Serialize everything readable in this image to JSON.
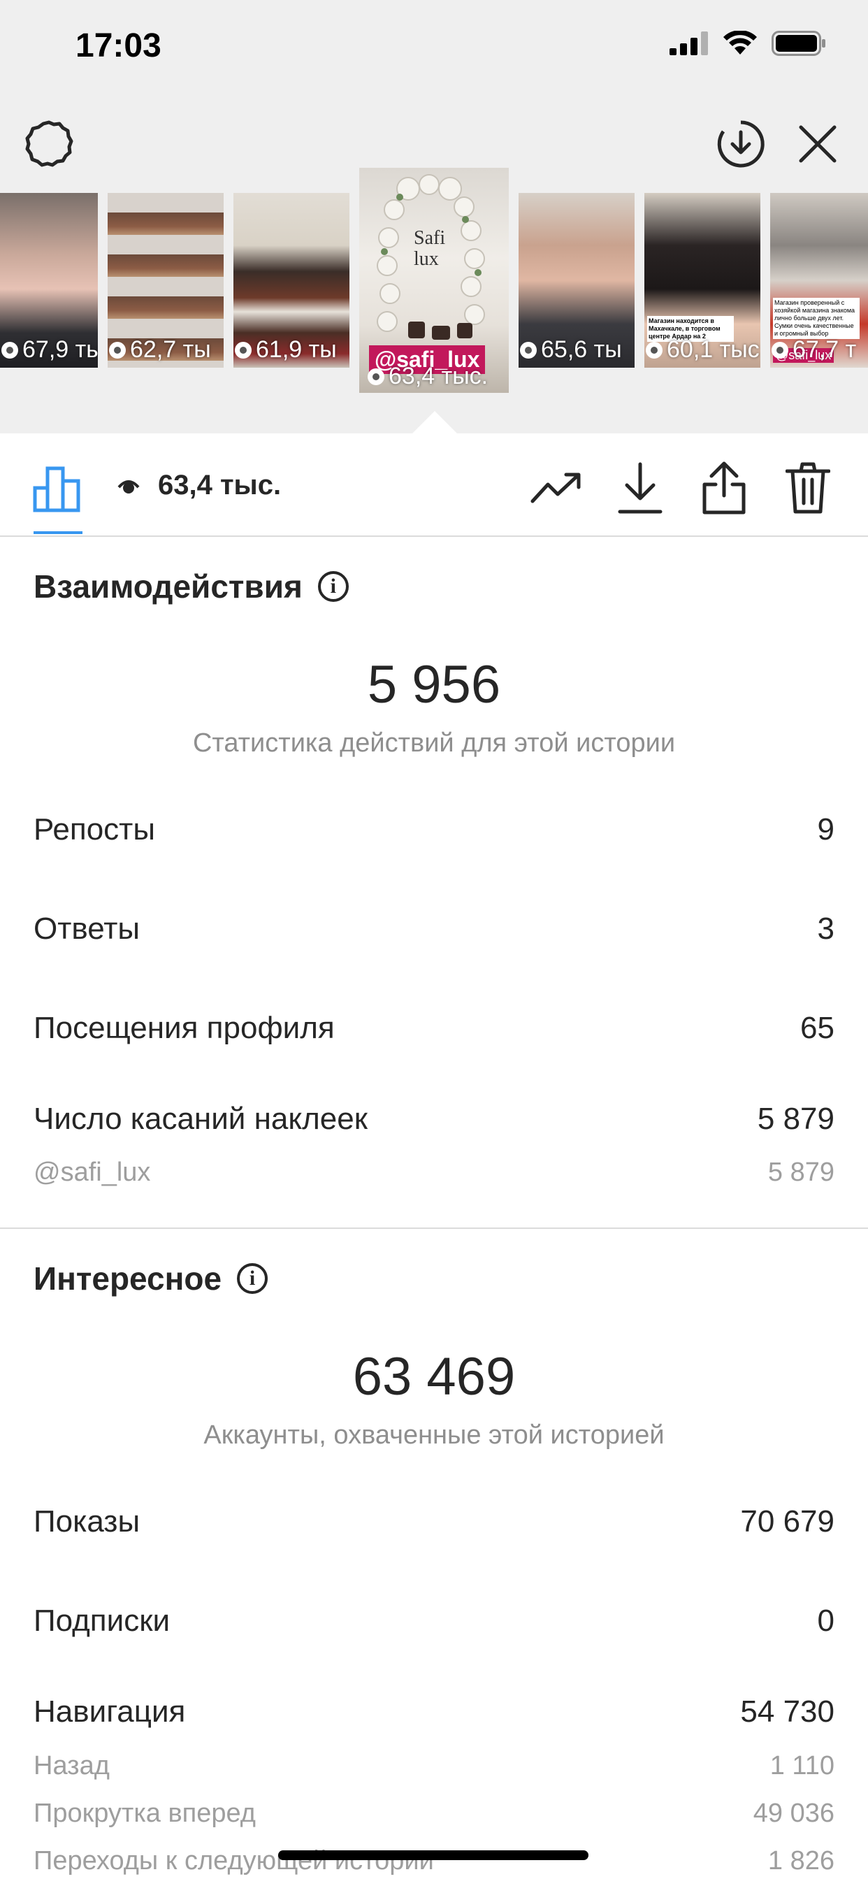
{
  "status_bar": {
    "time": "17:03"
  },
  "top_bar": {
    "settings_icon": "gear-icon",
    "save_icon": "download-circle-icon",
    "close_icon": "close-icon"
  },
  "stories": [
    {
      "views": "67,9 ты",
      "selected": false
    },
    {
      "views": "62,7 ты",
      "selected": false
    },
    {
      "views": "61,9 ты",
      "selected": false
    },
    {
      "views": "63,4 тыс.",
      "selected": true,
      "sticker": "@safi_lux",
      "sign": "Safi lux"
    },
    {
      "views": "65,6 ты",
      "selected": false
    },
    {
      "views": "60,1 тыс",
      "selected": false,
      "caption": "Магазин находится в Махачкале, в торговом центре Ардар на 2"
    },
    {
      "views": "67,7 т",
      "selected": false,
      "sticker": "@safi_lux",
      "caption": "Магазин проверенный с хозяйкой магазина знакома лично больше двух лет. Сумки очень качественные и огромный выбор"
    }
  ],
  "toolbar": {
    "views_label": "63,4 тыс.",
    "insights_icon": "bar-chart-icon",
    "views_icon": "eye-icon",
    "trend_icon": "trending-up-icon",
    "download_icon": "download-icon",
    "share_icon": "share-icon",
    "delete_icon": "trash-icon"
  },
  "interactions": {
    "title": "Взаимодействия",
    "total": "5 956",
    "subtitle": "Статистика действий для этой истории",
    "rows": [
      {
        "label": "Репосты",
        "value": "9"
      },
      {
        "label": "Ответы",
        "value": "3"
      },
      {
        "label": "Посещения профиля",
        "value": "65"
      },
      {
        "label": "Число касаний наклеек",
        "value": "5 879"
      }
    ],
    "sub_rows": [
      {
        "label": "@safi_lux",
        "value": "5 879"
      }
    ]
  },
  "discovery": {
    "title": "Интересное",
    "total": "63 469",
    "subtitle": "Аккаунты, охваченные этой историей",
    "rows": [
      {
        "label": "Показы",
        "value": "70 679"
      },
      {
        "label": "Подписки",
        "value": "0"
      },
      {
        "label": "Навигация",
        "value": "54 730"
      }
    ],
    "sub_rows": [
      {
        "label": "Назад",
        "value": "1 110"
      },
      {
        "label": "Прокрутка вперед",
        "value": "49 036"
      },
      {
        "label": "Переходы к следующей истории",
        "value": "1 826"
      }
    ]
  }
}
